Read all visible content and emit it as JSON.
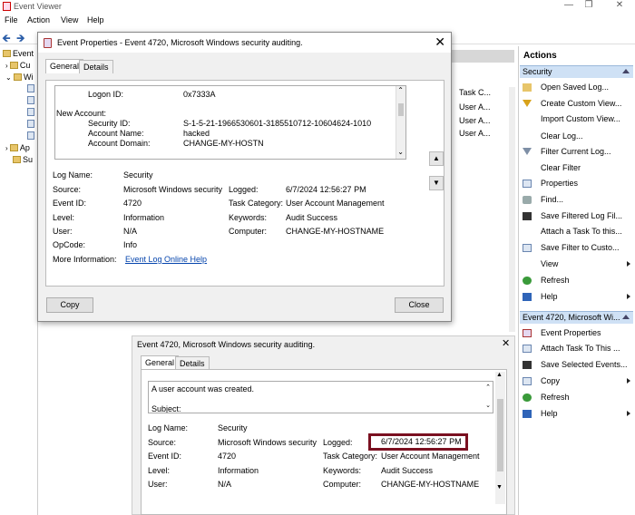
{
  "window": {
    "title": "Event Viewer"
  },
  "menu": [
    "File",
    "Action",
    "View",
    "Help"
  ],
  "tree": {
    "items": [
      "Event",
      "Cu",
      "Wi",
      "Ap",
      "Su"
    ]
  },
  "background_list": {
    "rows": [
      "Task C...",
      "User A...",
      "User A...",
      "User A..."
    ]
  },
  "actions": {
    "header": "Actions",
    "security_section": "Security",
    "security_items": [
      "Open Saved Log...",
      "Create Custom View...",
      "Import Custom View...",
      "Clear Log...",
      "Filter Current Log...",
      "Clear Filter",
      "Properties",
      "Find...",
      "Save Filtered Log Fil...",
      "Attach a Task To this...",
      "Save Filter to Custo...",
      "View",
      "Refresh",
      "Help"
    ],
    "event_section": "Event 4720, Microsoft Wi...",
    "event_items": [
      "Event Properties",
      "Attach Task To This ...",
      "Save Selected Events...",
      "Copy",
      "Refresh",
      "Help"
    ]
  },
  "dialog": {
    "title": "Event Properties - Event 4720, Microsoft Windows security auditing.",
    "tabs": [
      "General",
      "Details"
    ],
    "message_lines": [
      {
        "label": "Logon ID:",
        "value": "0x7333A"
      },
      {
        "label": "New Account:",
        "value": ""
      },
      {
        "label": "Security ID:",
        "value": "S-1-5-21-1966530601-3185510712-10604624-1010"
      },
      {
        "label": "Account Name:",
        "value": "hacked"
      },
      {
        "label": "Account Domain:",
        "value": "CHANGE-MY-HOSTN"
      }
    ],
    "fields": {
      "log_name_label": "Log Name:",
      "log_name": "Security",
      "source_label": "Source:",
      "source": "Microsoft Windows security",
      "logged_label": "Logged:",
      "logged": "6/7/2024 12:56:27 PM",
      "event_id_label": "Event ID:",
      "event_id": "4720",
      "task_category_label": "Task Category:",
      "task_category": "User Account Management",
      "level_label": "Level:",
      "level": "Information",
      "keywords_label": "Keywords:",
      "keywords": "Audit Success",
      "user_label": "User:",
      "user": "N/A",
      "computer_label": "Computer:",
      "computer": "CHANGE-MY-HOSTNAME",
      "opcode_label": "OpCode:",
      "opcode": "Info",
      "more_info_label": "More Information:",
      "more_info_link": "Event Log Online Help"
    },
    "copy_button": "Copy",
    "close_button": "Close"
  },
  "lower_pane": {
    "title": "Event 4720, Microsoft Windows security auditing.",
    "tabs": [
      "General",
      "Details"
    ],
    "message": "A user account was created.",
    "subject": "Subject:",
    "fields": {
      "log_name_label": "Log Name:",
      "log_name": "Security",
      "source_label": "Source:",
      "source": "Microsoft Windows security",
      "logged_label": "Logged:",
      "logged": "6/7/2024 12:56:27 PM",
      "event_id_label": "Event ID:",
      "event_id": "4720",
      "task_category_label": "Task Category:",
      "task_category": "User Account Management",
      "level_label": "Level:",
      "level": "Information",
      "keywords_label": "Keywords:",
      "keywords": "Audit Success",
      "user_label": "User:",
      "user": "N/A",
      "computer_label": "Computer:",
      "computer": "CHANGE-MY-HOSTNAME"
    }
  },
  "colors": {
    "section_bg": "#cfe1f5",
    "highlight_box": "#7a1020",
    "link": "#0645ad"
  }
}
